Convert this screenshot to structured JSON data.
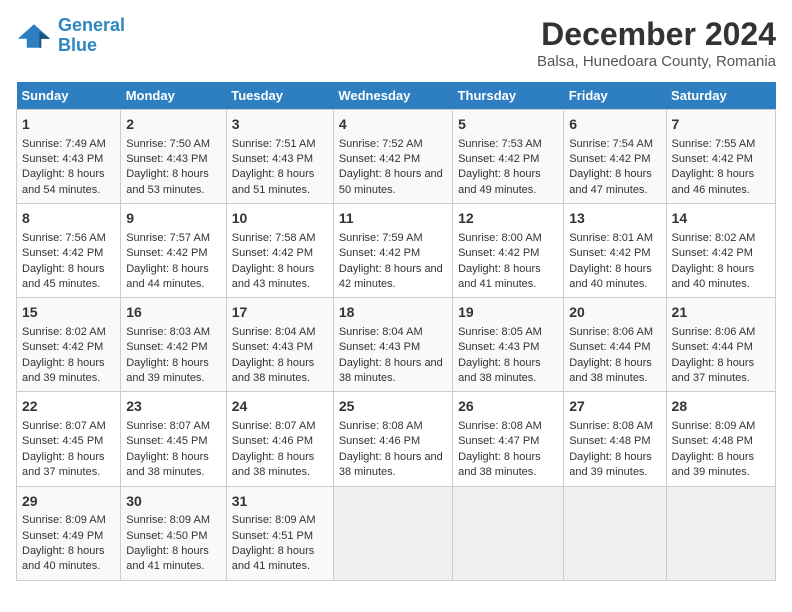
{
  "logo": {
    "line1": "General",
    "line2": "Blue"
  },
  "title": "December 2024",
  "subtitle": "Balsa, Hunedoara County, Romania",
  "days_header": [
    "Sunday",
    "Monday",
    "Tuesday",
    "Wednesday",
    "Thursday",
    "Friday",
    "Saturday"
  ],
  "weeks": [
    [
      {
        "day": "1",
        "sunrise": "7:49 AM",
        "sunset": "4:43 PM",
        "daylight": "8 hours and 54 minutes."
      },
      {
        "day": "2",
        "sunrise": "7:50 AM",
        "sunset": "4:43 PM",
        "daylight": "8 hours and 53 minutes."
      },
      {
        "day": "3",
        "sunrise": "7:51 AM",
        "sunset": "4:43 PM",
        "daylight": "8 hours and 51 minutes."
      },
      {
        "day": "4",
        "sunrise": "7:52 AM",
        "sunset": "4:42 PM",
        "daylight": "8 hours and 50 minutes."
      },
      {
        "day": "5",
        "sunrise": "7:53 AM",
        "sunset": "4:42 PM",
        "daylight": "8 hours and 49 minutes."
      },
      {
        "day": "6",
        "sunrise": "7:54 AM",
        "sunset": "4:42 PM",
        "daylight": "8 hours and 47 minutes."
      },
      {
        "day": "7",
        "sunrise": "7:55 AM",
        "sunset": "4:42 PM",
        "daylight": "8 hours and 46 minutes."
      }
    ],
    [
      {
        "day": "8",
        "sunrise": "7:56 AM",
        "sunset": "4:42 PM",
        "daylight": "8 hours and 45 minutes."
      },
      {
        "day": "9",
        "sunrise": "7:57 AM",
        "sunset": "4:42 PM",
        "daylight": "8 hours and 44 minutes."
      },
      {
        "day": "10",
        "sunrise": "7:58 AM",
        "sunset": "4:42 PM",
        "daylight": "8 hours and 43 minutes."
      },
      {
        "day": "11",
        "sunrise": "7:59 AM",
        "sunset": "4:42 PM",
        "daylight": "8 hours and 42 minutes."
      },
      {
        "day": "12",
        "sunrise": "8:00 AM",
        "sunset": "4:42 PM",
        "daylight": "8 hours and 41 minutes."
      },
      {
        "day": "13",
        "sunrise": "8:01 AM",
        "sunset": "4:42 PM",
        "daylight": "8 hours and 40 minutes."
      },
      {
        "day": "14",
        "sunrise": "8:02 AM",
        "sunset": "4:42 PM",
        "daylight": "8 hours and 40 minutes."
      }
    ],
    [
      {
        "day": "15",
        "sunrise": "8:02 AM",
        "sunset": "4:42 PM",
        "daylight": "8 hours and 39 minutes."
      },
      {
        "day": "16",
        "sunrise": "8:03 AM",
        "sunset": "4:42 PM",
        "daylight": "8 hours and 39 minutes."
      },
      {
        "day": "17",
        "sunrise": "8:04 AM",
        "sunset": "4:43 PM",
        "daylight": "8 hours and 38 minutes."
      },
      {
        "day": "18",
        "sunrise": "8:04 AM",
        "sunset": "4:43 PM",
        "daylight": "8 hours and 38 minutes."
      },
      {
        "day": "19",
        "sunrise": "8:05 AM",
        "sunset": "4:43 PM",
        "daylight": "8 hours and 38 minutes."
      },
      {
        "day": "20",
        "sunrise": "8:06 AM",
        "sunset": "4:44 PM",
        "daylight": "8 hours and 38 minutes."
      },
      {
        "day": "21",
        "sunrise": "8:06 AM",
        "sunset": "4:44 PM",
        "daylight": "8 hours and 37 minutes."
      }
    ],
    [
      {
        "day": "22",
        "sunrise": "8:07 AM",
        "sunset": "4:45 PM",
        "daylight": "8 hours and 37 minutes."
      },
      {
        "day": "23",
        "sunrise": "8:07 AM",
        "sunset": "4:45 PM",
        "daylight": "8 hours and 38 minutes."
      },
      {
        "day": "24",
        "sunrise": "8:07 AM",
        "sunset": "4:46 PM",
        "daylight": "8 hours and 38 minutes."
      },
      {
        "day": "25",
        "sunrise": "8:08 AM",
        "sunset": "4:46 PM",
        "daylight": "8 hours and 38 minutes."
      },
      {
        "day": "26",
        "sunrise": "8:08 AM",
        "sunset": "4:47 PM",
        "daylight": "8 hours and 38 minutes."
      },
      {
        "day": "27",
        "sunrise": "8:08 AM",
        "sunset": "4:48 PM",
        "daylight": "8 hours and 39 minutes."
      },
      {
        "day": "28",
        "sunrise": "8:09 AM",
        "sunset": "4:48 PM",
        "daylight": "8 hours and 39 minutes."
      }
    ],
    [
      {
        "day": "29",
        "sunrise": "8:09 AM",
        "sunset": "4:49 PM",
        "daylight": "8 hours and 40 minutes."
      },
      {
        "day": "30",
        "sunrise": "8:09 AM",
        "sunset": "4:50 PM",
        "daylight": "8 hours and 41 minutes."
      },
      {
        "day": "31",
        "sunrise": "8:09 AM",
        "sunset": "4:51 PM",
        "daylight": "8 hours and 41 minutes."
      },
      null,
      null,
      null,
      null
    ]
  ]
}
